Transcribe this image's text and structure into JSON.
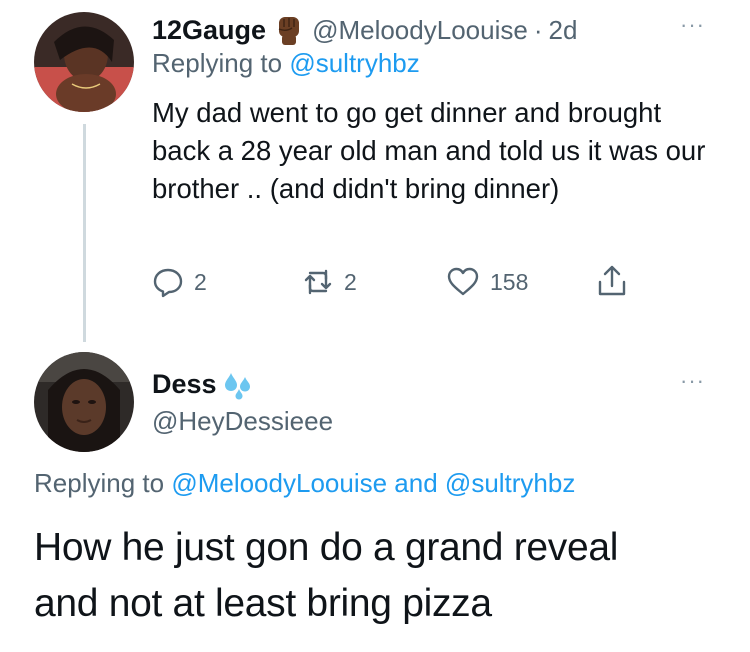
{
  "tweet1": {
    "display_name": "12Gauge",
    "name_emoji_icon": "raised-fist-dark-skin-icon",
    "handle": "@MeloodyLoouise",
    "separator": "·",
    "age": "2d",
    "replying_prefix": "Replying to",
    "replying_to": "@sultryhbz",
    "text": "My dad went to go get dinner and brought back a 28 year old man and told us it was our brother .. (and didn't bring dinner)",
    "more_label": "···",
    "actions": {
      "reply_count": "2",
      "retweet_count": "2",
      "like_count": "158"
    }
  },
  "tweet2": {
    "display_name": "Dess",
    "name_emoji_icon": "sweat-droplets-icon",
    "handle": "@HeyDessieee",
    "more_label": "···",
    "replying_prefix": "Replying to",
    "replying_to_1": "@MeloodyLoouise",
    "replying_and": "and",
    "replying_to_2": "@sultryhbz",
    "text_line1": "How he just gon do a grand reveal",
    "text_line2": "and not at least bring pizza"
  },
  "colors": {
    "link": "#1d9bf0",
    "muted": "#536471",
    "text": "#0f1419",
    "thread_line": "#cfd9de"
  }
}
